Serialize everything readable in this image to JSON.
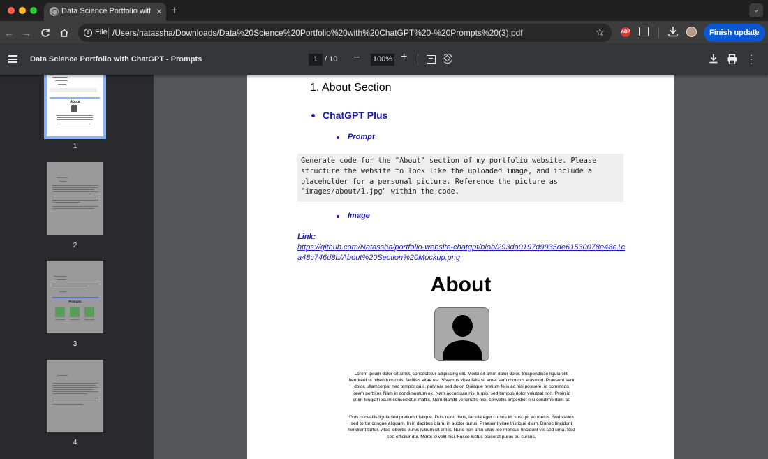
{
  "browser": {
    "tab_title": "Data Science Portfolio with ChatGPT - Prompts",
    "new_tab_symbol": "+",
    "scheme_label": "File",
    "url": "/Users/natassha/Downloads/Data%20Science%20Portfolio%20with%20ChatGPT%20-%20Prompts%20(3).pdf",
    "finish_update_label": "Finish update",
    "colors": {
      "finish_update": "#0b57d0",
      "abp": "#d03a36"
    }
  },
  "pdf_toolbar": {
    "title": "Data Science Portfolio with ChatGPT - Prompts",
    "current_page": "1",
    "total_pages": "/ 10",
    "zoom": "100%"
  },
  "thumbnails": [
    {
      "label": "1",
      "selected": true
    },
    {
      "label": "2",
      "selected": false
    },
    {
      "label": "3",
      "selected": false
    },
    {
      "label": "4",
      "selected": false
    }
  ],
  "thumbnail_texts": {
    "page1_heading": "About",
    "page3_heading": "Prompts"
  },
  "document": {
    "section_heading": "1. About Section",
    "subsection": "ChatGPT Plus",
    "prompt_heading": "Prompt",
    "prompt_code": "Generate code for the \"About\" section of my portfolio website. Please\nstructure the website to look like the uploaded image, and include a\nplaceholder for a personal picture. Reference the picture as\n\"images/about/1.jpg\" within the code.",
    "image_heading": "Image",
    "link_label": "Link:",
    "link_url": "https://github.com/Natassha/portfolio-website-chatgpt/blob/293da0197d9935de61530078e48e1ca48c746d8b/About%20Section%20Mockup.png",
    "mockup": {
      "title": "About",
      "paragraph1": "Lorem ipsum dolor sit amet, consectetur adipiscing elit. Morbi sit amet dolor dolor. Suspendisse ligula elit, hendrerit ut bibendum quis, facilisis vitae est. Vivamus vitae felis sit amet sem rhoncus euismod. Praesent sem dolor, ullamcorper nec tempor quis, pulvinar sed dolor. Quisque pretium felis ac nisi posuere, id commodo lorem porttitor. Nam in condimentum ex. Nam accumsan nisl turpis, sed tempus dolor volutpat non. Proin id enim feugiat ipsum consectetur mattis. Nam blandit venenatis nisi, convallis imperdiet nisi condimentum at.",
      "paragraph2": "Duis convallis ligula sed pretium tristique. Duis nunc risus, lacinia eget cursus id, suscipit ac metus. Sed varius sed tortor congue aliquam. In in dapibus diam, in auctor purus. Praesent vitae tristique diam. Donec tincidunt hendrerit tortor, vitae lobortis purus rutrum sit amet. Nunc non arcu vitae leo rhoncus tincidunt vel sed urna. Sed sed efficitur dui. Morbi id velit nisi. Fusce luctus placerat purus eu cursus."
    }
  }
}
